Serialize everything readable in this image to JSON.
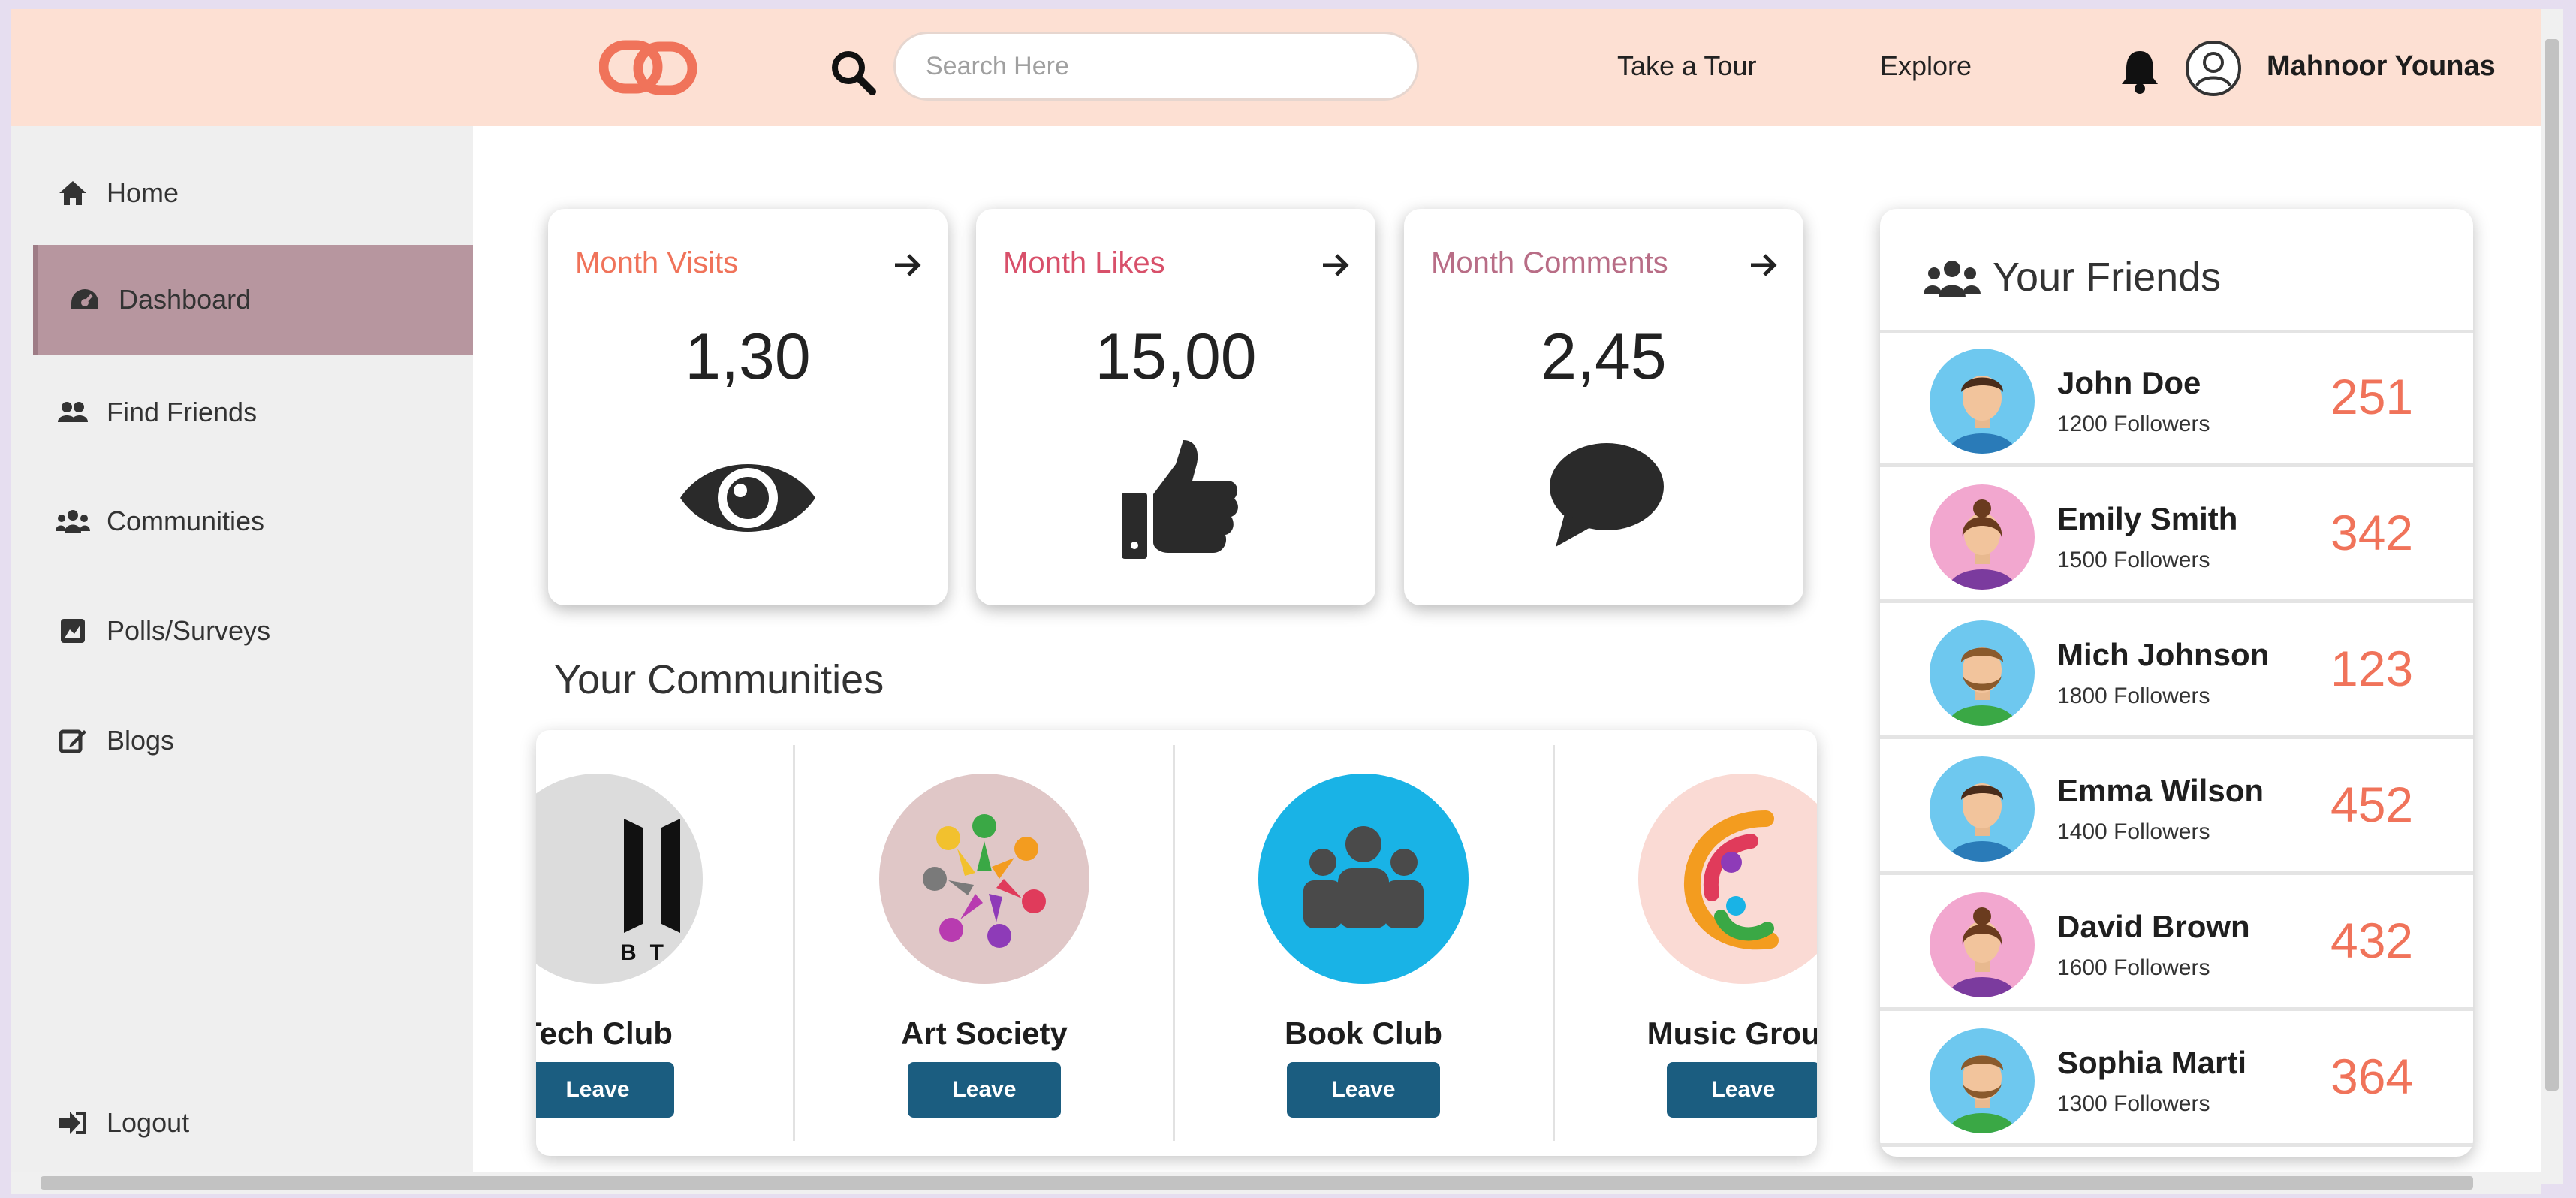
{
  "header": {
    "search_placeholder": "Search Here",
    "nav": [
      "Take a Tour",
      "Explore"
    ],
    "username": "Mahnoor Younas"
  },
  "sidebar": {
    "items": [
      {
        "label": "Home",
        "icon": "home-icon"
      },
      {
        "label": "Dashboard",
        "icon": "dashboard-icon",
        "active": true
      },
      {
        "label": "Find Friends",
        "icon": "users-icon"
      },
      {
        "label": "Communities",
        "icon": "group-icon"
      },
      {
        "label": "Polls/Surveys",
        "icon": "poll-icon"
      },
      {
        "label": "Blogs",
        "icon": "edit-icon"
      }
    ],
    "logout": "Logout"
  },
  "stats": [
    {
      "title": "Month Visits",
      "value": "1,30",
      "color": "#f0735a",
      "icon": "eye-icon"
    },
    {
      "title": "Month Likes",
      "value": "15,00",
      "color": "#d8506a",
      "icon": "thumbs-up-icon"
    },
    {
      "title": "Month Comments",
      "value": "2,45",
      "color": "#b86d86",
      "icon": "comment-icon"
    }
  ],
  "communities": {
    "title": "Your Communities",
    "items": [
      {
        "name": "Tech Club",
        "button": "Leave",
        "logo_text": "BTS"
      },
      {
        "name": "Art Society",
        "button": "Leave"
      },
      {
        "name": "Book Club",
        "button": "Leave"
      },
      {
        "name": "Music Group",
        "button": "Leave"
      }
    ]
  },
  "friends": {
    "title": "Your Friends",
    "items": [
      {
        "name": "John Doe",
        "followers": "1200 Followers",
        "count": "251",
        "gender": "m"
      },
      {
        "name": "Emily Smith",
        "followers": "1500 Followers",
        "count": "342",
        "gender": "f"
      },
      {
        "name": "Mich Johnson",
        "followers": "1800 Followers",
        "count": "123",
        "gender": "m2"
      },
      {
        "name": "Emma Wilson",
        "followers": "1400 Followers",
        "count": "452",
        "gender": "m"
      },
      {
        "name": "David Brown",
        "followers": "1600 Followers",
        "count": "432",
        "gender": "f"
      },
      {
        "name": "Sophia Marti",
        "followers": "1300 Followers",
        "count": "364",
        "gender": "m2"
      }
    ]
  },
  "colors": {
    "accent": "#f0735a",
    "header_bg": "#fde0d3",
    "active_nav": "#b7969f",
    "button": "#1b5d80"
  }
}
